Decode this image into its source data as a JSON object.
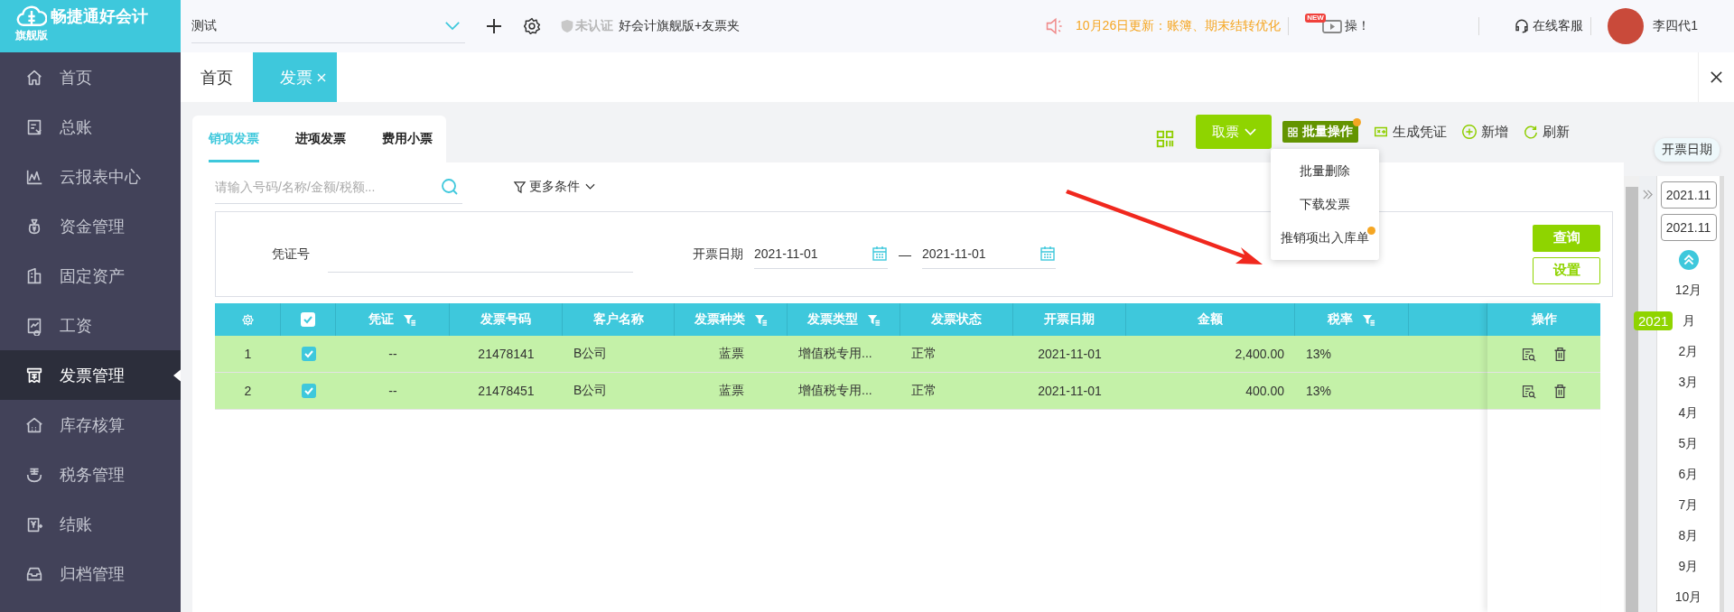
{
  "brand": {
    "name": "畅捷通好会计",
    "edition": "旗舰版"
  },
  "company_select": {
    "value": "测试"
  },
  "certification": {
    "status": "未认证",
    "product": "好会计旗舰版+友票夹"
  },
  "notice": {
    "text": "10月26日更新：账簿、期末结转优化"
  },
  "promo": {
    "badge": "NEW",
    "text": "操！"
  },
  "support": {
    "label": "在线客服"
  },
  "user": {
    "name": "李四代1"
  },
  "sidebar": {
    "items": [
      {
        "label": "首页",
        "selected": false
      },
      {
        "label": "总账",
        "selected": false
      },
      {
        "label": "云报表中心",
        "selected": false
      },
      {
        "label": "资金管理",
        "selected": false
      },
      {
        "label": "固定资产",
        "selected": false
      },
      {
        "label": "工资",
        "selected": false
      },
      {
        "label": "发票管理",
        "selected": true
      },
      {
        "label": "库存核算",
        "selected": false
      },
      {
        "label": "税务管理",
        "selected": false
      },
      {
        "label": "结账",
        "selected": false
      },
      {
        "label": "归档管理",
        "selected": false
      }
    ]
  },
  "page_tabs": [
    {
      "label": "首页",
      "selected": false,
      "closable": false
    },
    {
      "label": "发票",
      "selected": true,
      "closable": true
    }
  ],
  "invoice_tabs": [
    {
      "label": "销项发票",
      "selected": true
    },
    {
      "label": "进项发票",
      "selected": false
    },
    {
      "label": "费用小票",
      "selected": false
    }
  ],
  "toolbar": {
    "fetch": "取票",
    "batch": {
      "label": "批量操作",
      "dot": true
    },
    "actions": [
      {
        "label": "生成凭证",
        "kind": "voucher"
      },
      {
        "label": "新增",
        "kind": "add"
      },
      {
        "label": "刷新",
        "kind": "refresh"
      }
    ]
  },
  "batch_menu": [
    {
      "label": "批量删除",
      "dot": false
    },
    {
      "label": "下载发票",
      "dot": false
    },
    {
      "label": "推销项出入库单",
      "dot": true
    }
  ],
  "search": {
    "placeholder": "请输入号码/名称/金额/税额...",
    "more": "更多条件"
  },
  "filters": {
    "voucher_label": "凭证号",
    "date_label": "开票日期",
    "date_from": "2021-11-01",
    "separator": "—",
    "date_to": "2021-11-01",
    "query": "查询",
    "settings": "设置"
  },
  "table": {
    "header_checked": true,
    "columns": [
      {
        "label": "凭证",
        "filter": true
      },
      {
        "label": "发票号码",
        "filter": false
      },
      {
        "label": "客户名称",
        "filter": false
      },
      {
        "label": "发票种类",
        "filter": true
      },
      {
        "label": "发票类型",
        "filter": true
      },
      {
        "label": "发票状态",
        "filter": false
      },
      {
        "label": "开票日期",
        "filter": false
      },
      {
        "label": "金额",
        "filter": false
      },
      {
        "label": "税率",
        "filter": true
      }
    ],
    "actions_label": "操作",
    "rows": [
      {
        "index": "1",
        "checked": true,
        "cells": [
          "--",
          "21478141",
          "B公司",
          "蓝票",
          "增值税专用...",
          "正常",
          "2021-11-01",
          "2,400.00",
          "13%"
        ]
      },
      {
        "index": "2",
        "checked": true,
        "cells": [
          "--",
          "21478451",
          "B公司",
          "蓝票",
          "增值税专用...",
          "正常",
          "2021-11-01",
          "400.00",
          "13%"
        ]
      }
    ]
  },
  "timeline": {
    "label": "开票日期",
    "from": "2021.11",
    "to": "2021.11",
    "year": "2021",
    "months": [
      "12月",
      "月",
      "2月",
      "3月",
      "4月",
      "5月",
      "6月",
      "7月",
      "8月",
      "9月",
      "10月"
    ]
  }
}
